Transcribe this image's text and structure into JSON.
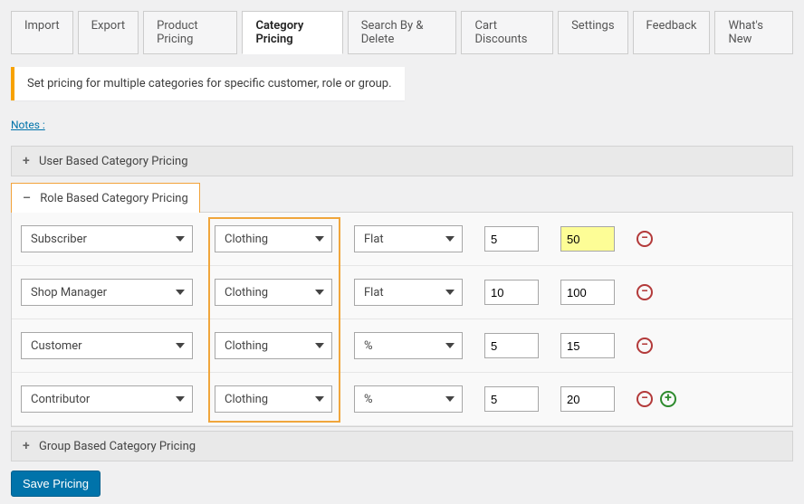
{
  "tabs": {
    "items": [
      "Import",
      "Export",
      "Product Pricing",
      "Category Pricing",
      "Search By & Delete",
      "Cart Discounts",
      "Settings",
      "Feedback",
      "What's New"
    ],
    "active_index": 3
  },
  "banner": "Set pricing for multiple categories for specific customer, role or group.",
  "notes_label": "Notes :",
  "accordions": {
    "user": {
      "label": "User Based Category Pricing",
      "expanded": false
    },
    "role": {
      "label": "Role Based Category Pricing",
      "expanded": true
    },
    "group": {
      "label": "Group Based Category Pricing",
      "expanded": false
    }
  },
  "rows": [
    {
      "role": "Subscriber",
      "category": "Clothing",
      "type": "Flat",
      "min_qty": "5",
      "price": "50",
      "price_highlight": true
    },
    {
      "role": "Shop Manager",
      "category": "Clothing",
      "type": "Flat",
      "min_qty": "10",
      "price": "100",
      "price_highlight": false
    },
    {
      "role": "Customer",
      "category": "Clothing",
      "type": "%",
      "min_qty": "5",
      "price": "15",
      "price_highlight": false
    },
    {
      "role": "Contributor",
      "category": "Clothing",
      "type": "%",
      "min_qty": "5",
      "price": "20",
      "price_highlight": false
    }
  ],
  "save_label": "Save Pricing"
}
